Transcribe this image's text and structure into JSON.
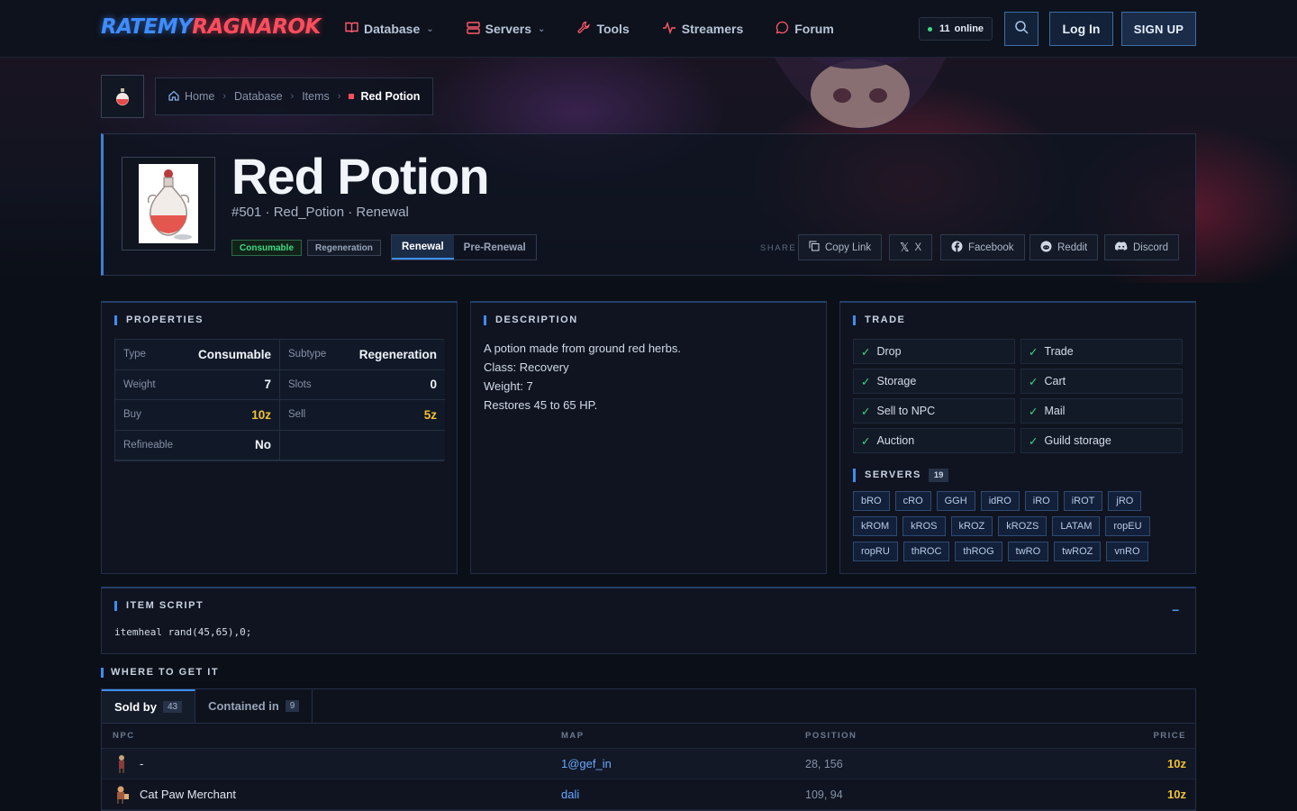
{
  "nav": {
    "logo_part1": "RATEMY",
    "logo_part2": "RAGNAROK",
    "items": [
      {
        "label": "Database",
        "icon": "book-icon",
        "dropdown": true
      },
      {
        "label": "Servers",
        "icon": "server-icon",
        "dropdown": true
      },
      {
        "label": "Tools",
        "icon": "wrench-icon",
        "dropdown": false
      },
      {
        "label": "Streamers",
        "icon": "activity-icon",
        "dropdown": false
      },
      {
        "label": "Forum",
        "icon": "chat-icon",
        "dropdown": false
      }
    ],
    "online_count": "11",
    "online_label": "online",
    "login_label": "Log In",
    "signup_label": "SIGN UP"
  },
  "breadcrumb": {
    "items": [
      "Home",
      "Database",
      "Items"
    ],
    "current": "Red Potion"
  },
  "item": {
    "name": "Red Potion",
    "subtitle": "#501 · Red_Potion · Renewal",
    "tags": [
      "Consumable",
      "Regeneration"
    ],
    "versions": [
      "Renewal",
      "Pre-Renewal"
    ],
    "active_version": "Renewal"
  },
  "share": {
    "label": "SHARE",
    "buttons": [
      "Copy Link",
      "X",
      "Facebook",
      "Reddit",
      "Discord"
    ]
  },
  "properties": {
    "title": "PROPERTIES",
    "rows": [
      {
        "k1": "Type",
        "v1": "Consumable",
        "k2": "Subtype",
        "v2": "Regeneration"
      },
      {
        "k1": "Weight",
        "v1": "7",
        "k2": "Slots",
        "v2": "0"
      },
      {
        "k1": "Buy",
        "v1": "10z",
        "k2": "Sell",
        "v2": "5z"
      },
      {
        "k1": "Refineable",
        "v1": "No",
        "k2": "",
        "v2": ""
      }
    ]
  },
  "description": {
    "title": "DESCRIPTION",
    "lines": [
      "A potion made from ground red herbs.",
      "Class: Recovery",
      "Weight: 7",
      "Restores 45 to 65 HP."
    ]
  },
  "trade": {
    "title": "TRADE",
    "items": [
      "Drop",
      "Trade",
      "Storage",
      "Cart",
      "Sell to NPC",
      "Mail",
      "Auction",
      "Guild storage"
    ]
  },
  "servers": {
    "title": "SERVERS",
    "count": "19",
    "list": [
      "bRO",
      "cRO",
      "GGH",
      "idRO",
      "iRO",
      "iROT",
      "jRO",
      "kROM",
      "kROS",
      "kROZ",
      "kROZS",
      "LATAM",
      "ropEU",
      "ropRU",
      "thROC",
      "thROG",
      "twRO",
      "twROZ",
      "vnRO"
    ]
  },
  "script": {
    "title": "ITEM SCRIPT",
    "code": "itemheal rand(45,65),0;",
    "collapse_symbol": "–"
  },
  "where": {
    "title": "WHERE TO GET IT",
    "tabs": [
      {
        "label": "Sold by",
        "count": "43"
      },
      {
        "label": "Contained in",
        "count": "9"
      }
    ],
    "headers": [
      "NPC",
      "MAP",
      "POSITION",
      "PRICE"
    ],
    "rows": [
      {
        "npc": "-",
        "map": "1@gef_in",
        "position": "28, 156",
        "price": "10z"
      },
      {
        "npc": "Cat Paw Merchant",
        "map": "dali",
        "position": "109, 94",
        "price": "10z"
      }
    ]
  },
  "colors": {
    "accent": "#3d8ef0",
    "brand_red": "#ff4d5e",
    "gold": "#f2c230",
    "green": "#3ddc84"
  }
}
